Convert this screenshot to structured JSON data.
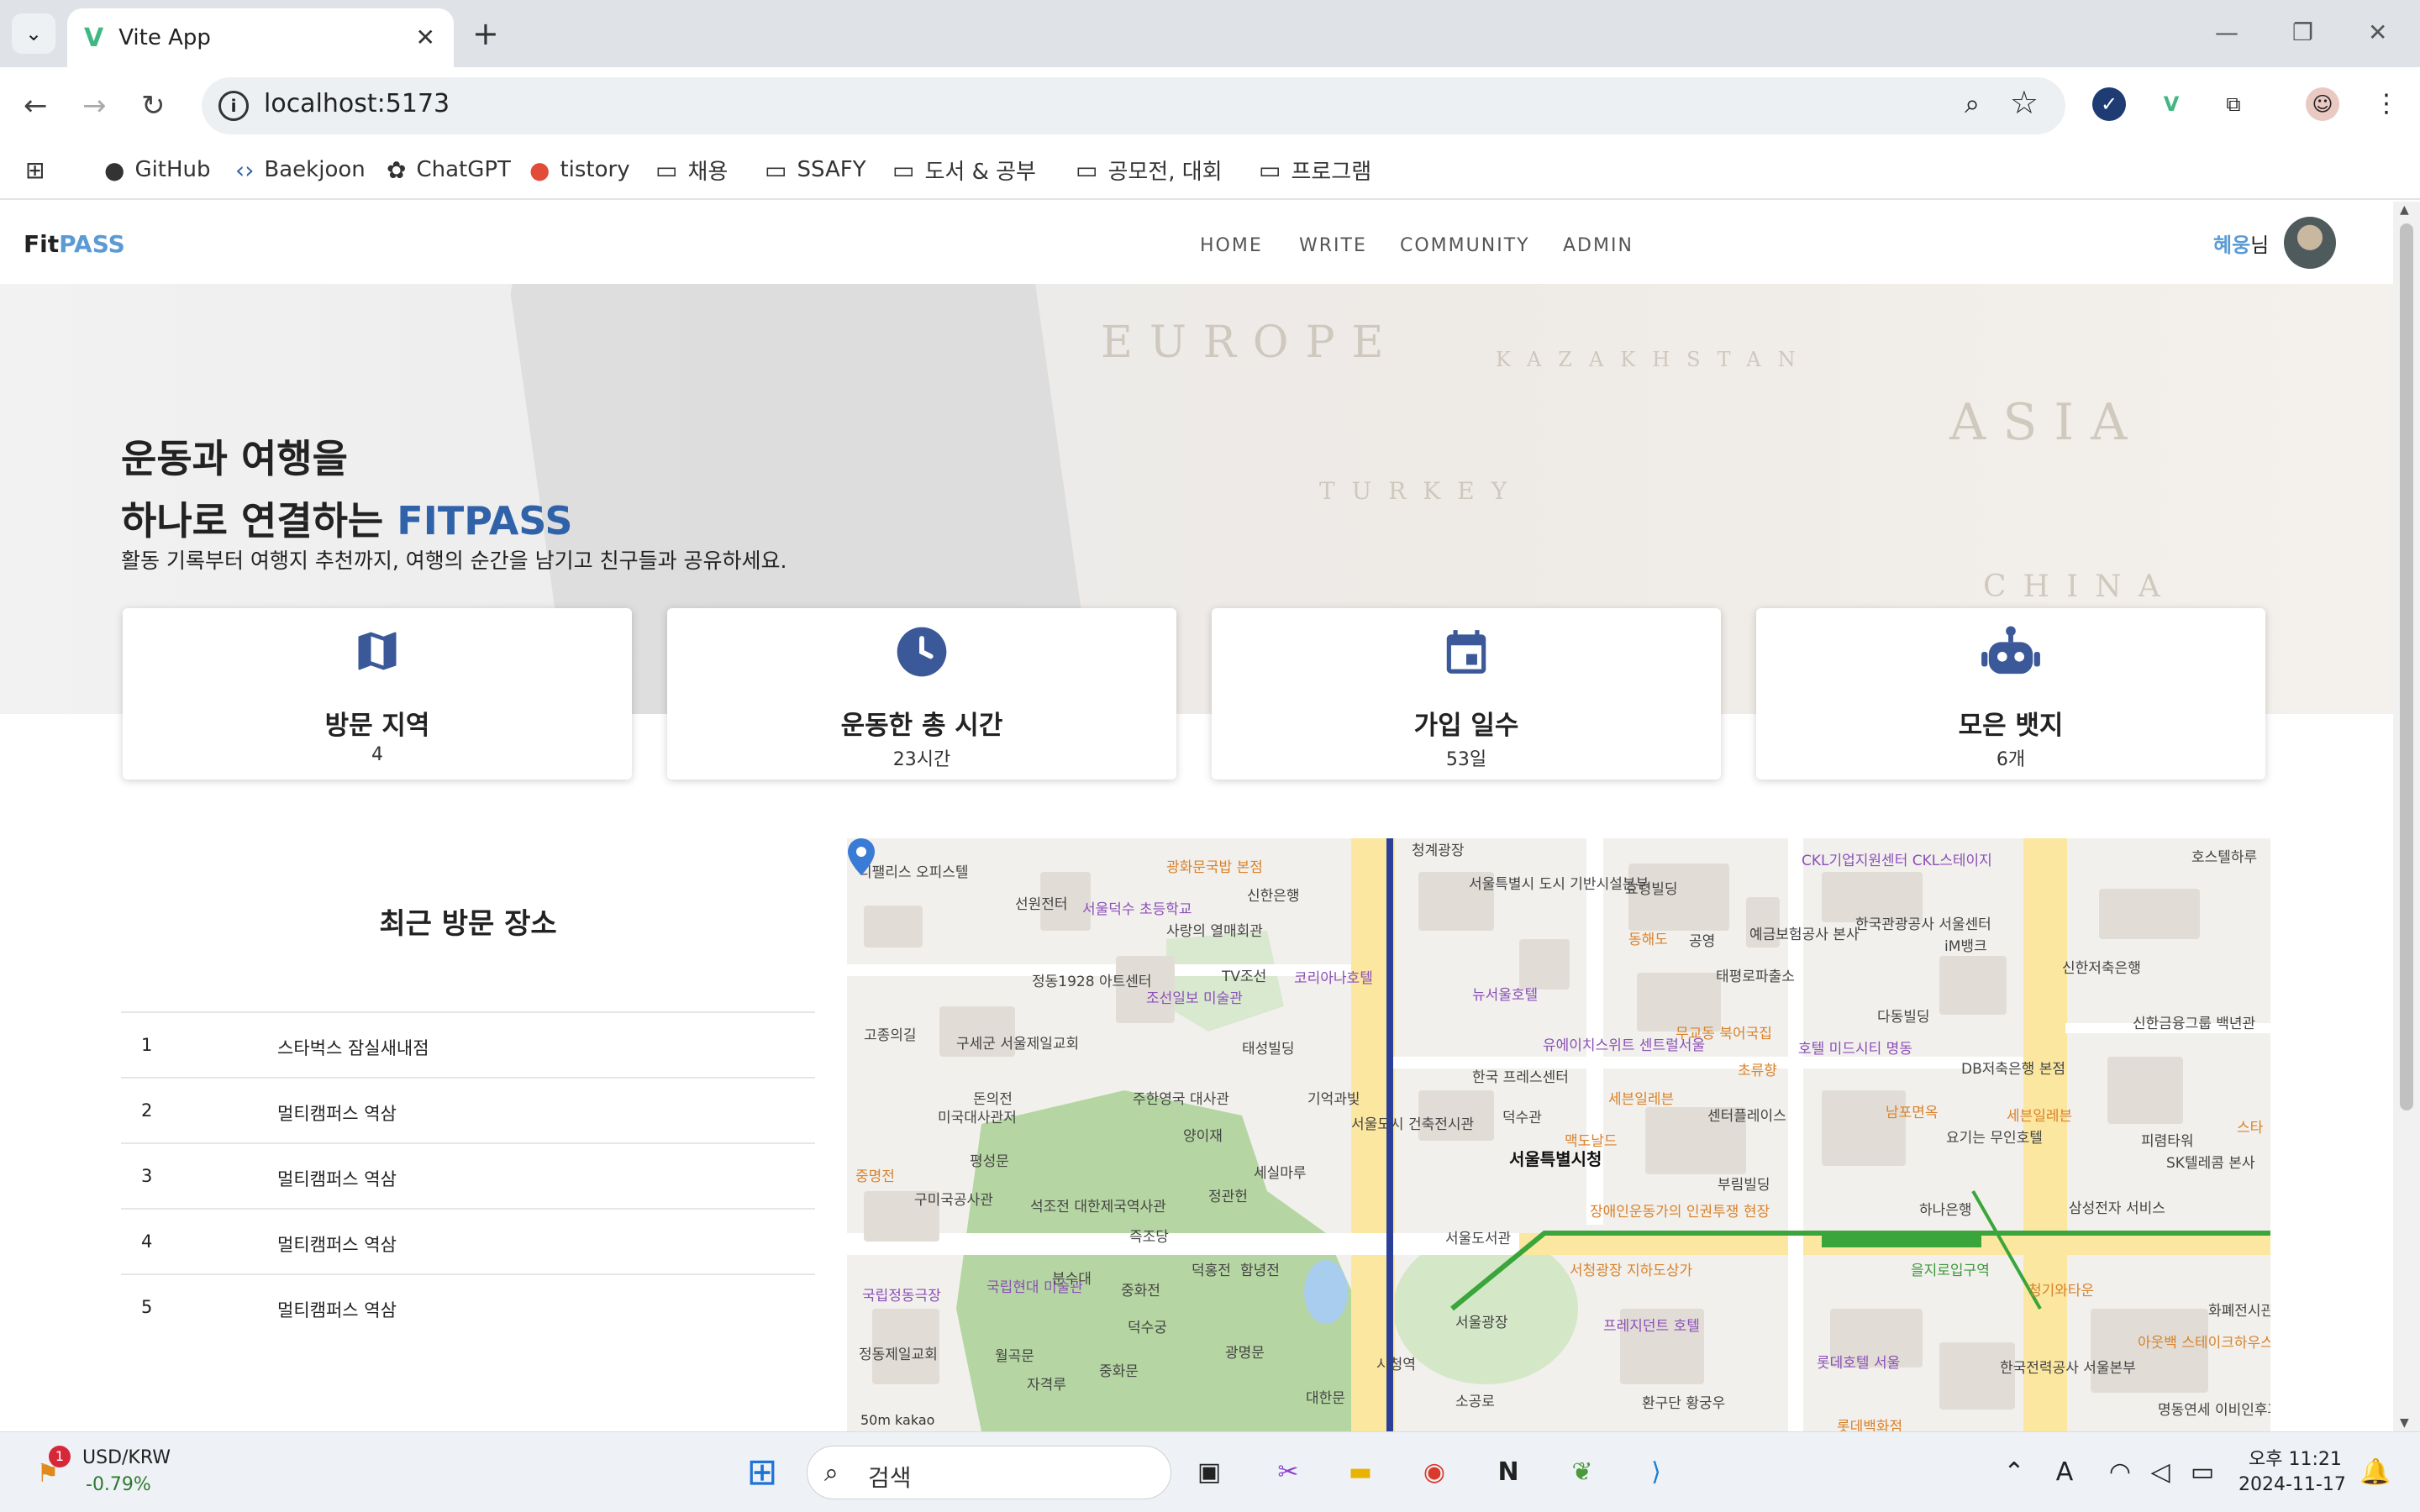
{
  "browser": {
    "tab_title": "Vite App",
    "url": "localhost:5173",
    "bookmarks": [
      "GitHub",
      "Baekjoon",
      "ChatGPT",
      "tistory",
      "채용",
      "SSAFY",
      "도서 & 공부",
      "공모전, 대회",
      "프로그램"
    ]
  },
  "app": {
    "logo_fit": "Fit",
    "logo_pass": "PASS",
    "nav": [
      "HOME",
      "WRITE",
      "COMMUNITY",
      "ADMIN"
    ],
    "user_name": "혜웅",
    "user_suffix": "님"
  },
  "hero": {
    "line1": "운동과 여행을",
    "line2": "하나로 연결하는",
    "brand": "FITPASS",
    "subtitle": "활동 기록부터 여행지 추천까지, 여행의 순간을 남기고 친구들과 공유하세요.",
    "map_words": [
      "EUROPE",
      "KAZAKHSTAN",
      "ASIA",
      "TURKEY",
      "CHINA"
    ]
  },
  "stats": [
    {
      "label": "방문 지역",
      "value": "4",
      "icon": "map-icon"
    },
    {
      "label": "운동한 총 시간",
      "value": "23시간",
      "icon": "clock-icon"
    },
    {
      "label": "가입 일수",
      "value": "53일",
      "icon": "calendar-icon"
    },
    {
      "label": "모은 뱃지",
      "value": "6개",
      "icon": "robot-icon"
    }
  ],
  "recent": {
    "title": "최근 방문 장소",
    "rows": [
      {
        "no": "1",
        "place": "스타벅스 잠실새내점"
      },
      {
        "no": "2",
        "place": "멀티캠퍼스 역삼"
      },
      {
        "no": "3",
        "place": "멀티캠퍼스 역삼"
      },
      {
        "no": "4",
        "place": "멀티캠퍼스 역삼"
      },
      {
        "no": "5",
        "place": "멀티캠퍼스 역삼"
      }
    ]
  },
  "map": {
    "center_label": "서울특별시청",
    "labels": [
      "광화문국밥 본점",
      "청계광장",
      "서울특별시 도시 기반시설본부",
      "효령빌딩",
      "CKL기업지원센터 CKL스테이지",
      "호스텔하루",
      "디팰리스 오피스텔",
      "선원전터",
      "신한은행",
      "서울덕수 초등학교",
      "사랑의 열매회관",
      "정동1928 아트센터",
      "조선일보 미술관",
      "TV조선",
      "코리아나호텔",
      "뉴서울호텔",
      "동해도",
      "공영",
      "예금보험공사 본사",
      "한국관광공사 서울센터",
      "iM뱅크",
      "신한저축은행",
      "태평로파출소",
      "다동빌딩",
      "신한금융그룹 백년관",
      "구세군 서울제일교회",
      "태성빌딩",
      "유에이치스위트 센트럴서울",
      "무교동 북어국집",
      "호텔 미드시티 명동",
      "DB저축은행 본점",
      "고종의길",
      "돈의전",
      "주한영국 대사관",
      "한국 프레스센터",
      "세븐일레븐",
      "초류향",
      "남포면옥",
      "미국대사관저",
      "양이재",
      "기억과빛",
      "서울도시 건축전시관",
      "덕수관",
      "센터플레이스",
      "세븐일레븐",
      "피렴타워",
      "평성문",
      "세실마루",
      "맥도날드",
      "요기는 무인호텔",
      "중명전",
      "구미국공사관",
      "석조전 대한제국역사관",
      "정관헌",
      "부림빌딩",
      "하나은행",
      "삼성전자 서비스",
      "SK텔레콤 본사",
      "즉조당",
      "덕수궁",
      "서울도서관",
      "장애인운동가의 인권투쟁 현장",
      "국립정동극장",
      "국립현대 미술관",
      "분수대",
      "중화전",
      "덕홍전",
      "함녕전",
      "서울광장",
      "서청광장 지하도상가",
      "을지로입구역",
      "청기와타운",
      "화폐전시관",
      "정동제일교회",
      "월곡문",
      "자격루",
      "중화문",
      "광명문",
      "대한문",
      "시청역",
      "프레지던트 호텔",
      "롯데호텔 서울",
      "아웃백 스테이크하우스",
      "한국전력공사 서울본부",
      "명동연세 이비인후과의원",
      "소공로",
      "환구단 황궁우",
      "롯데백화점",
      "스타"
    ],
    "scale_text": "50m",
    "provider": "kakao"
  },
  "taskbar": {
    "currency": "USD/KRW",
    "change": "-0.79%",
    "badge": "1",
    "search_placeholder": "검색",
    "time": "오후 11:21",
    "date": "2024-11-17"
  }
}
